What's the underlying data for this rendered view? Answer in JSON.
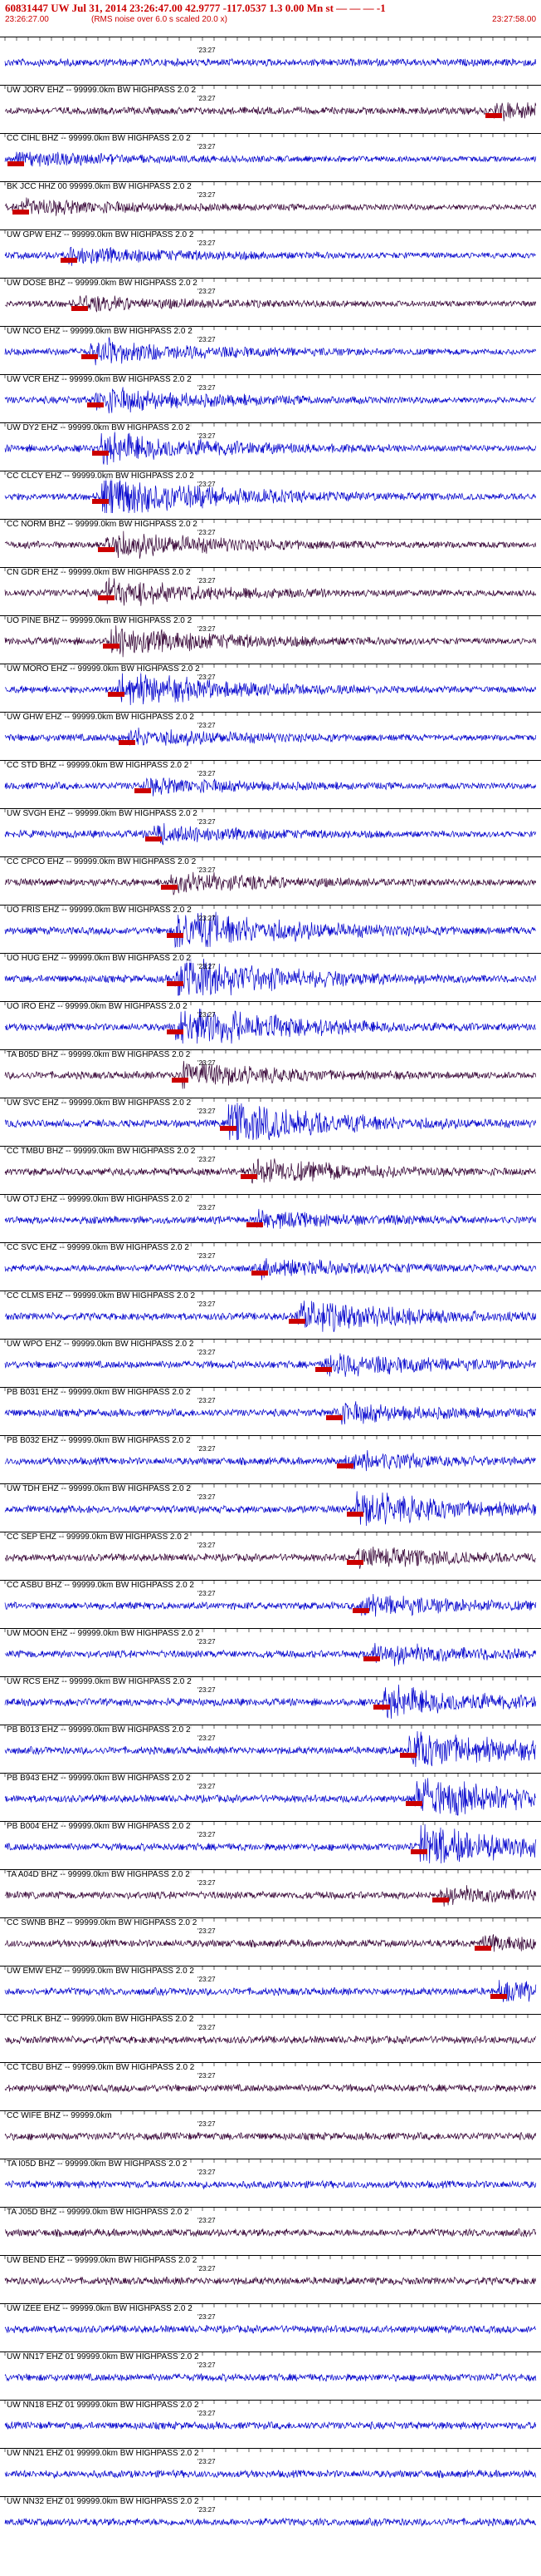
{
  "header": {
    "title": "60831447 UW Jul 31, 2014 23:26:47.00   42.9777 -117.0537   1.3 0.00 Mn st — — — -1",
    "start_time": "23:26:27.00",
    "end_time": "23:27:58.00",
    "subtitle": "(RMS noise over 6.0 s scaled 20.0 x)"
  },
  "tick_label": "'23:27",
  "colors": {
    "blue": "#0000cc",
    "dark": "#330033",
    "pick": "#cc0000"
  },
  "traces": [
    {
      "label": "",
      "color": "blue",
      "amp": 0.55,
      "pick": null
    },
    {
      "label": "UW JORV EHZ -- 99999.0km BW  HIGHPASS  2.0  2",
      "color": "dark",
      "amp": 0.35,
      "pick": 0.92
    },
    {
      "label": "CC CIHL BHZ -- 99999.0km BW  HIGHPASS  2.0  2",
      "color": "blue",
      "amp": 0.3,
      "pick": 0.02
    },
    {
      "label": "BK JCC HHZ 00 99999.0km BW  HIGHPASS  2.0  2",
      "color": "dark",
      "amp": 0.35,
      "pick": 0.03
    },
    {
      "label": "UW GPW EHZ -- 99999.0km BW  HIGHPASS  2.0  2",
      "color": "blue",
      "amp": 0.4,
      "pick": 0.12
    },
    {
      "label": "UW DOSE BHZ -- 99999.0km BW  HIGHPASS  2.0  2",
      "color": "dark",
      "amp": 0.3,
      "pick": 0.14
    },
    {
      "label": "UW NCO EHZ -- 99999.0km BW  HIGHPASS  2.0  2",
      "color": "blue",
      "amp": 0.55,
      "pick": 0.16
    },
    {
      "label": "UW VCR EHZ -- 99999.0km BW  HIGHPASS  2.0  2",
      "color": "blue",
      "amp": 0.55,
      "pick": 0.17
    },
    {
      "label": "UW DY2 EHZ -- 99999.0km BW  HIGHPASS  2.0  2",
      "color": "blue",
      "amp": 0.7,
      "pick": 0.18
    },
    {
      "label": "CC CLCY EHZ -- 99999.0km BW  HIGHPASS  2.0  2",
      "color": "blue",
      "amp": 0.95,
      "pick": 0.18
    },
    {
      "label": "CC NORM BHZ -- 99999.0km BW  HIGHPASS  2.0  2",
      "color": "dark",
      "amp": 0.6,
      "pick": 0.19
    },
    {
      "label": "CN GDR EHZ -- 99999.0km BW  HIGHPASS  2.0  2",
      "color": "dark",
      "amp": 0.55,
      "pick": 0.19
    },
    {
      "label": "UO PINE BHZ -- 99999.0km BW  HIGHPASS  2.0  2",
      "color": "dark",
      "amp": 0.7,
      "pick": 0.2
    },
    {
      "label": "UW MORO EHZ -- 99999.0km BW  HIGHPASS  2.0  2",
      "color": "blue",
      "amp": 0.75,
      "pick": 0.21
    },
    {
      "label": "UW GHW EHZ -- 99999.0km BW  HIGHPASS  2.0  2",
      "color": "blue",
      "amp": 0.4,
      "pick": 0.23
    },
    {
      "label": "CC STD BHZ -- 99999.0km BW  HIGHPASS  2.0  2",
      "color": "blue",
      "amp": 0.35,
      "pick": 0.26
    },
    {
      "label": "UW SVGH EHZ -- 99999.0km BW  HIGHPASS  2.0  2",
      "color": "blue",
      "amp": 0.4,
      "pick": 0.28
    },
    {
      "label": "CC CPCO EHZ -- 99999.0km BW  HIGHPASS  2.0  2",
      "color": "dark",
      "amp": 0.45,
      "pick": 0.31
    },
    {
      "label": "UO FRIS EHZ -- 99999.0km BW  HIGHPASS  2.0  2",
      "color": "blue",
      "amp": 1.0,
      "pick": 0.32
    },
    {
      "label": "UO HUG EHZ -- 99999.0km BW  HIGHPASS  2.0  2",
      "color": "blue",
      "amp": 1.0,
      "pick": 0.32
    },
    {
      "label": "UO IRO EHZ -- 99999.0km BW  HIGHPASS  2.0  2",
      "color": "blue",
      "amp": 1.0,
      "pick": 0.32
    },
    {
      "label": "TA B05D BHZ -- 99999.0km BW  HIGHPASS  2.0  2",
      "color": "dark",
      "amp": 0.55,
      "pick": 0.33
    },
    {
      "label": "UW SVC EHZ -- 99999.0km BW  HIGHPASS  2.0  2",
      "color": "blue",
      "amp": 0.95,
      "pick": 0.42
    },
    {
      "label": "CC TMBU BHZ -- 99999.0km BW  HIGHPASS  2.0  2",
      "color": "dark",
      "amp": 0.55,
      "pick": 0.46
    },
    {
      "label": "UW OTJ EHZ -- 99999.0km BW  HIGHPASS  2.0  2",
      "color": "blue",
      "amp": 0.35,
      "pick": 0.47
    },
    {
      "label": "CC SVC EHZ -- 99999.0km BW  HIGHPASS  2.0  2",
      "color": "blue",
      "amp": 0.4,
      "pick": 0.48
    },
    {
      "label": "CC CLMS EHZ -- 99999.0km BW  HIGHPASS  2.0  2",
      "color": "blue",
      "amp": 0.7,
      "pick": 0.55
    },
    {
      "label": "UW WPO EHZ -- 99999.0km BW  HIGHPASS  2.0  2",
      "color": "blue",
      "amp": 0.55,
      "pick": 0.6
    },
    {
      "label": "PB B031 EHZ -- 99999.0km BW  HIGHPASS  2.0  2",
      "color": "blue",
      "amp": 0.45,
      "pick": 0.62
    },
    {
      "label": "PB B032 EHZ -- 99999.0km BW  HIGHPASS  2.0  2",
      "color": "blue",
      "amp": 0.4,
      "pick": 0.64
    },
    {
      "label": "UW TDH EHZ -- 99999.0km BW  HIGHPASS  2.0  2",
      "color": "blue",
      "amp": 0.8,
      "pick": 0.66
    },
    {
      "label": "CC SEP EHZ -- 99999.0km BW  HIGHPASS  2.0  2",
      "color": "dark",
      "amp": 0.45,
      "pick": 0.66
    },
    {
      "label": "CC ASBU BHZ -- 99999.0km BW  HIGHPASS  2.0  2",
      "color": "blue",
      "amp": 0.45,
      "pick": 0.67
    },
    {
      "label": "UW MOON EHZ -- 99999.0km BW  HIGHPASS  2.0  2",
      "color": "blue",
      "amp": 0.45,
      "pick": 0.69
    },
    {
      "label": "UW RCS EHZ -- 99999.0km BW  HIGHPASS  2.0  2",
      "color": "blue",
      "amp": 0.7,
      "pick": 0.71
    },
    {
      "label": "PB B013 EHZ -- 99999.0km BW  HIGHPASS  2.0  2",
      "color": "blue",
      "amp": 0.9,
      "pick": 0.76
    },
    {
      "label": "PB B943 EHZ -- 99999.0km BW  HIGHPASS  2.0  2",
      "color": "blue",
      "amp": 0.9,
      "pick": 0.77
    },
    {
      "label": "PB B004 EHZ -- 99999.0km BW  HIGHPASS  2.0  2",
      "color": "blue",
      "amp": 0.9,
      "pick": 0.78
    },
    {
      "label": "TA A04D BHZ -- 99999.0km BW  HIGHPASS  2.0  2",
      "color": "dark",
      "amp": 0.35,
      "pick": 0.82
    },
    {
      "label": "CC SWNB BHZ -- 99999.0km BW  HIGHPASS  2.0  2",
      "color": "dark",
      "amp": 0.35,
      "pick": 0.9
    },
    {
      "label": "UW EMW EHZ -- 99999.0km BW  HIGHPASS  2.0  2",
      "color": "blue",
      "amp": 0.45,
      "pick": 0.93
    },
    {
      "label": "CC PRLK BHZ -- 99999.0km BW  HIGHPASS  2.0  2",
      "color": "dark",
      "amp": 0.3,
      "pick": null
    },
    {
      "label": "CC TCBU BHZ -- 99999.0km BW  HIGHPASS  2.0  2",
      "color": "dark",
      "amp": 0.3,
      "pick": null
    },
    {
      "label": "CC WIFE BHZ -- 99999.0km",
      "color": "dark",
      "amp": 0.25,
      "pick": null
    },
    {
      "label": "TA I05D BHZ -- 99999.0km BW  HIGHPASS  2.0  2",
      "color": "blue",
      "amp": 0.35,
      "pick": null
    },
    {
      "label": "TA J05D BHZ -- 99999.0km BW  HIGHPASS  2.0  2",
      "color": "dark",
      "amp": 0.4,
      "pick": null
    },
    {
      "label": "UW BEND EHZ -- 99999.0km BW  HIGHPASS  2.0  2",
      "color": "dark",
      "amp": 0.35,
      "pick": null
    },
    {
      "label": "UW IZEE EHZ -- 99999.0km BW  HIGHPASS  2.0  2",
      "color": "blue",
      "amp": 0.35,
      "pick": null
    },
    {
      "label": "UW NN17 EHZ 01 99999.0km BW  HIGHPASS  2.0  2",
      "color": "blue",
      "amp": 0.35,
      "pick": null
    },
    {
      "label": "UW NN18 EHZ 01 99999.0km BW  HIGHPASS  2.0  2",
      "color": "blue",
      "amp": 0.35,
      "pick": null
    },
    {
      "label": "UW NN21 EHZ 01 99999.0km BW  HIGHPASS  2.0  2",
      "color": "blue",
      "amp": 0.35,
      "pick": null
    },
    {
      "label": "UW NN32 EHZ 01 99999.0km BW  HIGHPASS  2.0  2",
      "color": "blue",
      "amp": 0.35,
      "pick": null
    }
  ]
}
